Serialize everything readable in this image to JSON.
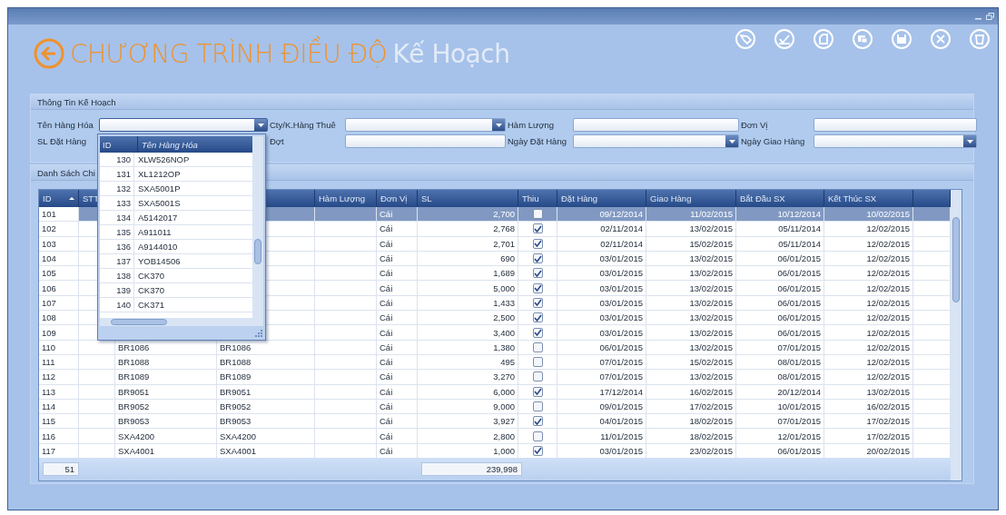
{
  "header": {
    "title_main": "CHƯƠNG TRÌNH ĐIỀU ĐỘ",
    "title_sub": "Kế Hoạch"
  },
  "plan_info": {
    "title": "Thông Tin Kế Hoạch",
    "fields": [
      {
        "label": "Tên Hàng Hóa",
        "kind": "combo",
        "open": true
      },
      {
        "label": "Cty/K.Hàng Thuê",
        "kind": "combo",
        "open": false
      },
      {
        "label": "Hàm Lượng",
        "kind": "text"
      },
      {
        "label": "Đơn Vị",
        "kind": "text"
      },
      {
        "label": "SL Đặt Hàng",
        "kind": "hidden"
      },
      {
        "label": "Đợt",
        "kind": "text"
      },
      {
        "label": "Ngày Đặt Hàng",
        "kind": "combo",
        "open": false
      },
      {
        "label": "Ngày Giao Hàng",
        "kind": "combo",
        "open": false
      }
    ]
  },
  "dropdown": {
    "columns": [
      "ID",
      "Tên Hàng Hóa"
    ],
    "rows": [
      {
        "id": "130",
        "name": "XLW526NOP"
      },
      {
        "id": "131",
        "name": "XL1212OP"
      },
      {
        "id": "132",
        "name": "SXA5001P"
      },
      {
        "id": "133",
        "name": "SXA5001S"
      },
      {
        "id": "134",
        "name": "A5142017"
      },
      {
        "id": "135",
        "name": "A911011"
      },
      {
        "id": "136",
        "name": "A9144010"
      },
      {
        "id": "137",
        "name": "YOB14506"
      },
      {
        "id": "138",
        "name": "CK370"
      },
      {
        "id": "139",
        "name": "CK370"
      },
      {
        "id": "140",
        "name": "CK371"
      }
    ]
  },
  "detail": {
    "title": "Danh Sách Chi",
    "columns": [
      "ID",
      "STT",
      "Hàm Lượng",
      "Đơn Vị",
      "SL",
      "Thiu",
      "Đặt Hàng",
      "Giao Hàng",
      "Bắt Đầu SX",
      "Kết Thúc SX"
    ],
    "rows": [
      {
        "id": "101",
        "unit": "Cái",
        "sl": "2,700",
        "thiu": false,
        "dat_hang": "09/12/2014",
        "giao_hang": "11/02/2015",
        "bat_dau": "10/12/2014",
        "ket_thuc": "10/02/2015",
        "selected": true
      },
      {
        "id": "102",
        "unit": "Cái",
        "sl": "2,768",
        "thiu": true,
        "dat_hang": "02/11/2014",
        "giao_hang": "13/02/2015",
        "bat_dau": "05/11/2014",
        "ket_thuc": "12/02/2015",
        "selected": false
      },
      {
        "id": "103",
        "unit": "Cái",
        "sl": "2,701",
        "thiu": true,
        "dat_hang": "02/11/2014",
        "giao_hang": "15/02/2015",
        "bat_dau": "05/11/2014",
        "ket_thuc": "12/02/2015",
        "selected": false
      },
      {
        "id": "104",
        "unit": "Cái",
        "sl": "690",
        "thiu": true,
        "dat_hang": "03/01/2015",
        "giao_hang": "13/02/2015",
        "bat_dau": "06/01/2015",
        "ket_thuc": "12/02/2015",
        "selected": false
      },
      {
        "id": "105",
        "unit": "Cái",
        "sl": "1,689",
        "thiu": true,
        "dat_hang": "03/01/2015",
        "giao_hang": "13/02/2015",
        "bat_dau": "06/01/2015",
        "ket_thuc": "12/02/2015",
        "selected": false
      },
      {
        "id": "106",
        "unit": "Cái",
        "sl": "5,000",
        "thiu": true,
        "dat_hang": "03/01/2015",
        "giao_hang": "13/02/2015",
        "bat_dau": "06/01/2015",
        "ket_thuc": "12/02/2015",
        "selected": false
      },
      {
        "id": "107",
        "unit": "Cái",
        "sl": "1,433",
        "thiu": true,
        "dat_hang": "03/01/2015",
        "giao_hang": "13/02/2015",
        "bat_dau": "06/01/2015",
        "ket_thuc": "12/02/2015",
        "selected": false
      },
      {
        "id": "108",
        "unit": "Cái",
        "sl": "2,500",
        "thiu": true,
        "dat_hang": "03/01/2015",
        "giao_hang": "13/02/2015",
        "bat_dau": "06/01/2015",
        "ket_thuc": "12/02/2015",
        "selected": false
      },
      {
        "id": "109",
        "unit": "Cái",
        "sl": "3,400",
        "thiu": true,
        "dat_hang": "03/01/2015",
        "giao_hang": "13/02/2015",
        "bat_dau": "06/01/2015",
        "ket_thuc": "12/02/2015",
        "selected": false
      },
      {
        "id": "110",
        "column_3": "BR1086",
        "column_4": "BR1086",
        "unit": "Cái",
        "sl": "1,380",
        "thiu": false,
        "dat_hang": "06/01/2015",
        "giao_hang": "13/02/2015",
        "bat_dau": "07/01/2015",
        "ket_thuc": "12/02/2015",
        "selected": false
      },
      {
        "id": "111",
        "column_3": "BR1088",
        "column_4": "BR1088",
        "unit": "Cái",
        "sl": "495",
        "thiu": false,
        "dat_hang": "07/01/2015",
        "giao_hang": "15/02/2015",
        "bat_dau": "08/01/2015",
        "ket_thuc": "12/02/2015",
        "selected": false
      },
      {
        "id": "112",
        "column_3": "BR1089",
        "column_4": "BR1089",
        "unit": "Cái",
        "sl": "3,270",
        "thiu": false,
        "dat_hang": "07/01/2015",
        "giao_hang": "13/02/2015",
        "bat_dau": "08/01/2015",
        "ket_thuc": "12/02/2015",
        "selected": false
      },
      {
        "id": "113",
        "column_3": "BR9051",
        "column_4": "BR9051",
        "unit": "Cái",
        "sl": "6,000",
        "thiu": true,
        "dat_hang": "17/12/2014",
        "giao_hang": "16/02/2015",
        "bat_dau": "20/12/2014",
        "ket_thuc": "13/02/2015",
        "selected": false
      },
      {
        "id": "114",
        "column_3": "BR9052",
        "column_4": "BR9052",
        "unit": "Cái",
        "sl": "9,000",
        "thiu": false,
        "dat_hang": "09/01/2015",
        "giao_hang": "17/02/2015",
        "bat_dau": "10/01/2015",
        "ket_thuc": "16/02/2015",
        "selected": false
      },
      {
        "id": "115",
        "column_3": "BR9053",
        "column_4": "BR9053",
        "unit": "Cái",
        "sl": "3,927",
        "thiu": true,
        "dat_hang": "04/01/2015",
        "giao_hang": "18/02/2015",
        "bat_dau": "07/01/2015",
        "ket_thuc": "17/02/2015",
        "selected": false
      },
      {
        "id": "116",
        "column_3": "SXA4200",
        "column_4": "SXA4200",
        "unit": "Cái",
        "sl": "2,800",
        "thiu": false,
        "dat_hang": "11/01/2015",
        "giao_hang": "18/02/2015",
        "bat_dau": "12/01/2015",
        "ket_thuc": "17/02/2015",
        "selected": false
      },
      {
        "id": "117",
        "column_3": "SXA4001",
        "column_4": "SXA4001",
        "unit": "Cái",
        "sl": "1,000",
        "thiu": true,
        "dat_hang": "03/01/2015",
        "giao_hang": "23/02/2015",
        "bat_dau": "06/01/2015",
        "ket_thuc": "20/02/2015",
        "selected": false
      }
    ],
    "summary": {
      "count": "51",
      "total_sl": "239,998"
    }
  }
}
